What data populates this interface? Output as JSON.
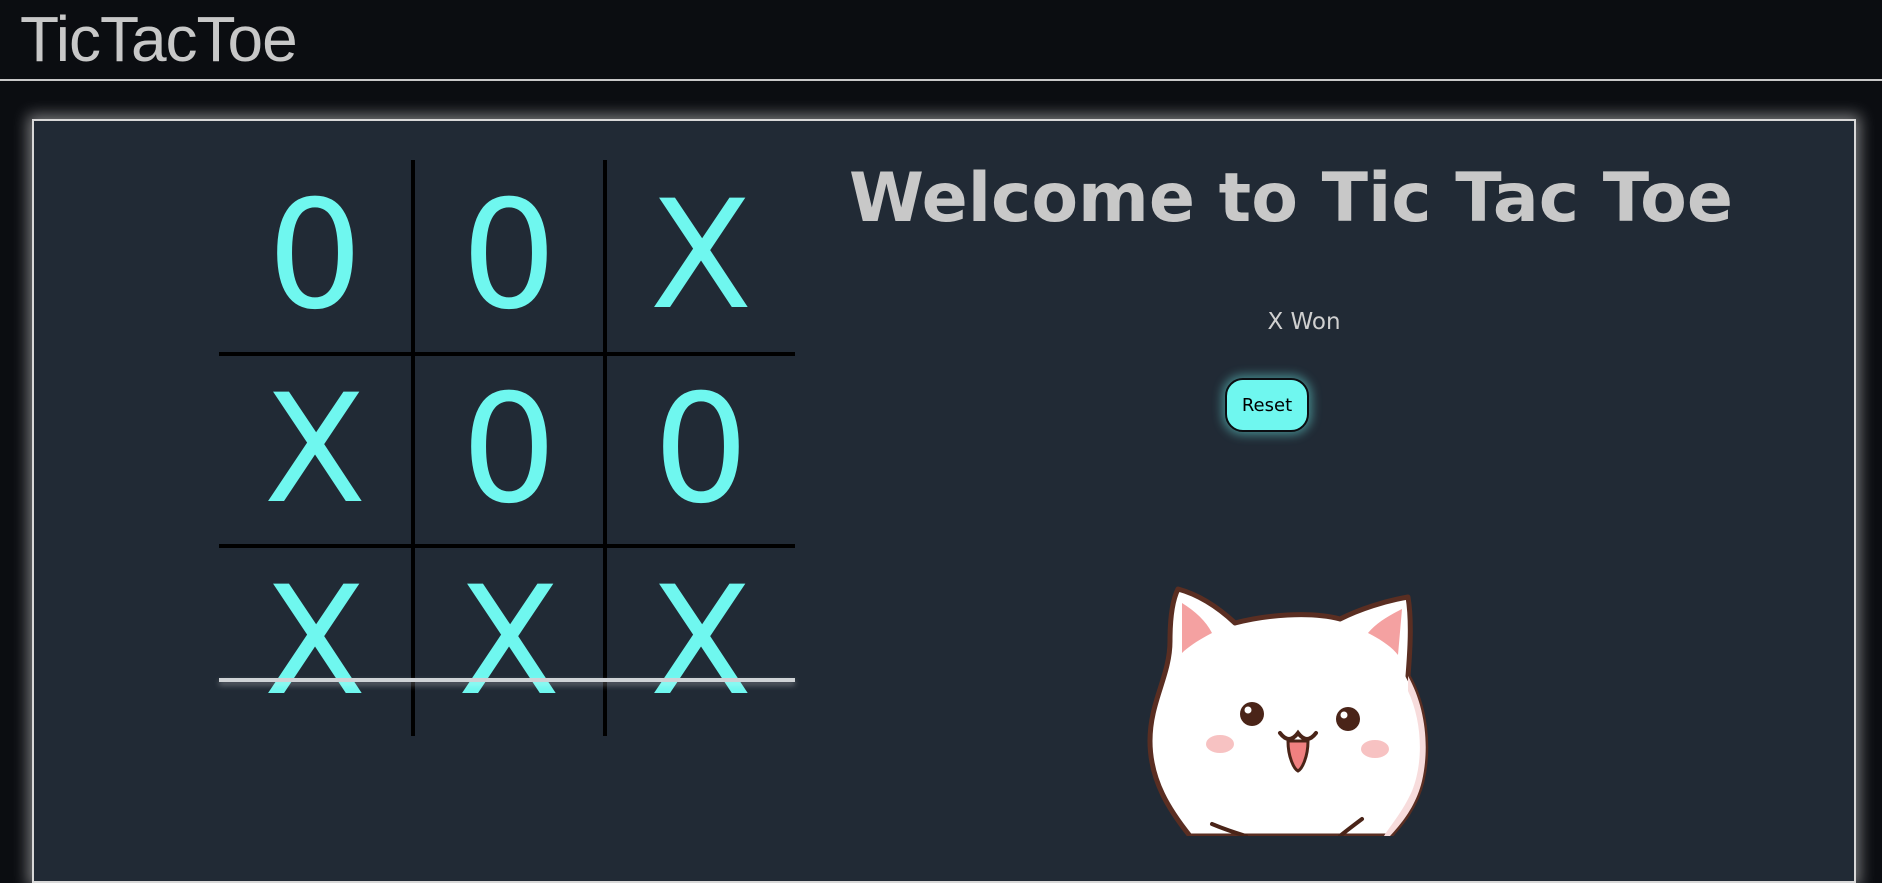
{
  "navbar": {
    "brand": "TicTacToe"
  },
  "game": {
    "title": "Welcome to Tic Tac Toe",
    "status": "X Won",
    "reset_label": "Reset",
    "board": [
      [
        "0",
        "0",
        "X"
      ],
      [
        "X",
        "0",
        "0"
      ],
      [
        "X",
        "X",
        "X"
      ]
    ],
    "winning_row": 3
  },
  "colors": {
    "accent": "#6ff7ef",
    "panel_background": "#212a35",
    "page_background": "#0b0d11",
    "text": "#c8c8c8"
  },
  "decoration": {
    "image": "cute-white-cat-sticker"
  }
}
